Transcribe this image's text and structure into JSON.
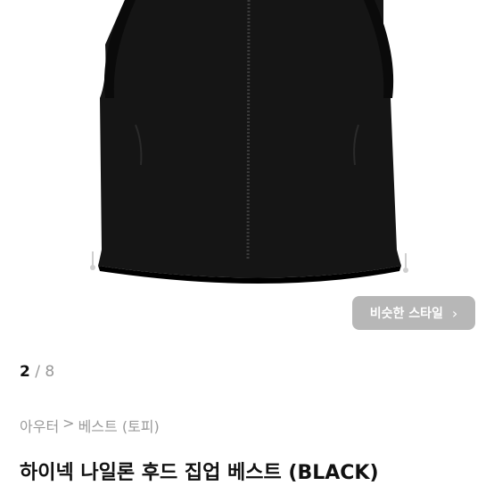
{
  "gallery": {
    "current_index": "2",
    "separator": "/",
    "total": "8",
    "similar_style_label": "비슷한 스타일",
    "similar_style_icon": "chevron-right-icon"
  },
  "breadcrumb": {
    "items": [
      "아우터",
      ">",
      "베스트 (토피)"
    ]
  },
  "product": {
    "title": "하이넥 나일론 후드 집업 베스트 (BLACK)"
  },
  "colors": {
    "vest": "#151515",
    "button_bg": "#aaaaaa"
  }
}
